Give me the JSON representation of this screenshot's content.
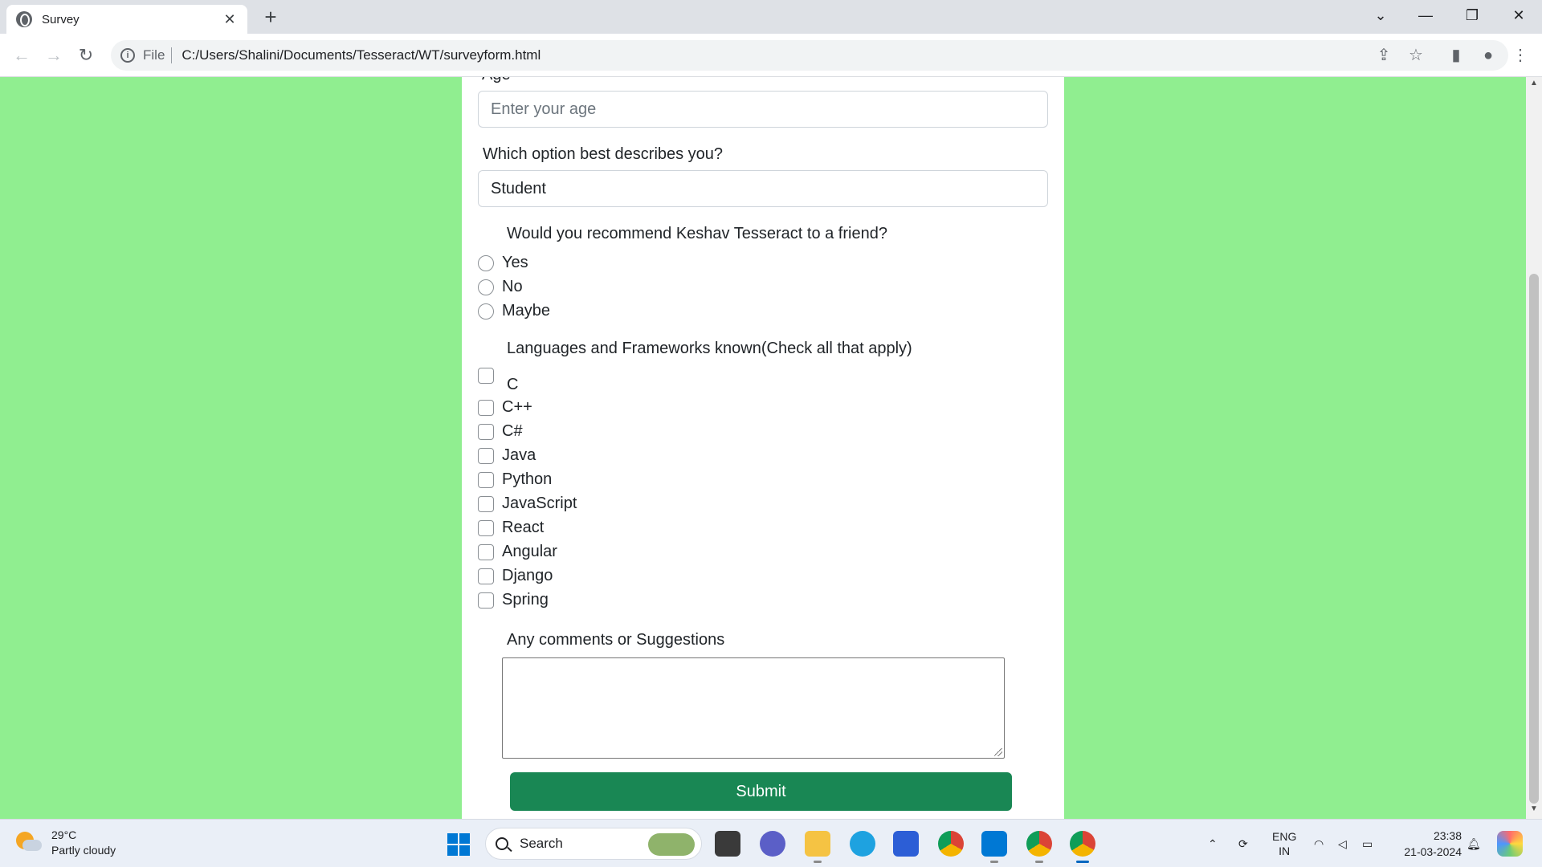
{
  "browser": {
    "tab_title": "Survey",
    "tab_close": "✕",
    "new_tab": "+",
    "scheme": "File",
    "url": "C:/Users/Shalini/Documents/Tesseract/WT/surveyform.html"
  },
  "form": {
    "age_label": "Age",
    "age_placeholder": "Enter your age",
    "role_label": "Which option best describes you?",
    "role_value": "Student",
    "recommend_label": "Would you recommend Keshav Tesseract to a friend?",
    "recommend_options": [
      "Yes",
      "No",
      "Maybe"
    ],
    "languages_label": "Languages and Frameworks known(Check all that apply)",
    "languages": [
      "C",
      "C++",
      "C#",
      "Java",
      "Python",
      "JavaScript",
      "React",
      "Angular",
      "Django",
      "Spring"
    ],
    "comments_label": "Any comments or Suggestions",
    "submit_label": "Submit"
  },
  "colors": {
    "page_background": "#90ee90",
    "submit_button": "#198754"
  },
  "taskbar": {
    "temperature": "29°C",
    "weather": "Partly cloudy",
    "search_label": "Search",
    "language": "ENG",
    "region": "IN",
    "time": "23:38",
    "date": "21-03-2024"
  }
}
